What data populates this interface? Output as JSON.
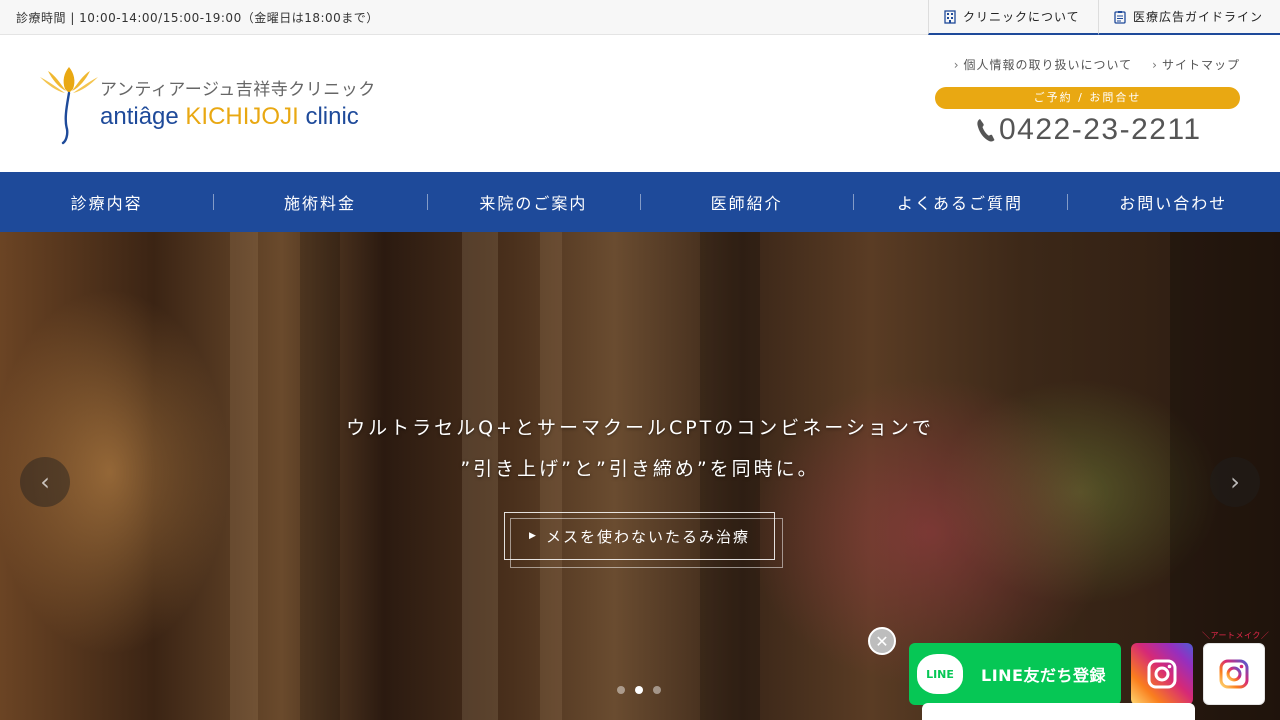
{
  "topbar": {
    "hours": "診療時間 | 10:00-14:00/15:00-19:00（金曜日は18:00まで）",
    "links": [
      {
        "label": "クリニックについて",
        "icon": "building-icon"
      },
      {
        "label": "医療広告ガイドライン",
        "icon": "clipboard-icon"
      }
    ]
  },
  "header": {
    "logo_jp": "アンティアージュ吉祥寺クリニック",
    "logo_en_1": "antiâge",
    "logo_en_2": "KICHIJOJI",
    "logo_en_3": "clinic",
    "sublinks": [
      "個人情報の取り扱いについて",
      "サイトマップ"
    ],
    "reserve_label": "ご予約 / お問合せ",
    "phone": "0422-23-2211"
  },
  "nav": {
    "items": [
      "診療内容",
      "施術料金",
      "来院のご案内",
      "医師紹介",
      "よくあるご質問",
      "お問い合わせ"
    ]
  },
  "hero": {
    "line1": "ウルトラセルQ+とサーマクールCPTのコンビネーションで",
    "line2": "”引き上げ”と”引き締め”を同時に。",
    "button_label": "メスを使わないたるみ治療",
    "slides": 3,
    "active_slide": 2
  },
  "floating": {
    "line_label": "LINE友だち登録",
    "line_logo": "LINE",
    "artmake_label": "＼アートメイク／"
  },
  "colors": {
    "brand_blue": "#1e4a9a",
    "accent_gold": "#e9a812",
    "line_green": "#06c755"
  }
}
